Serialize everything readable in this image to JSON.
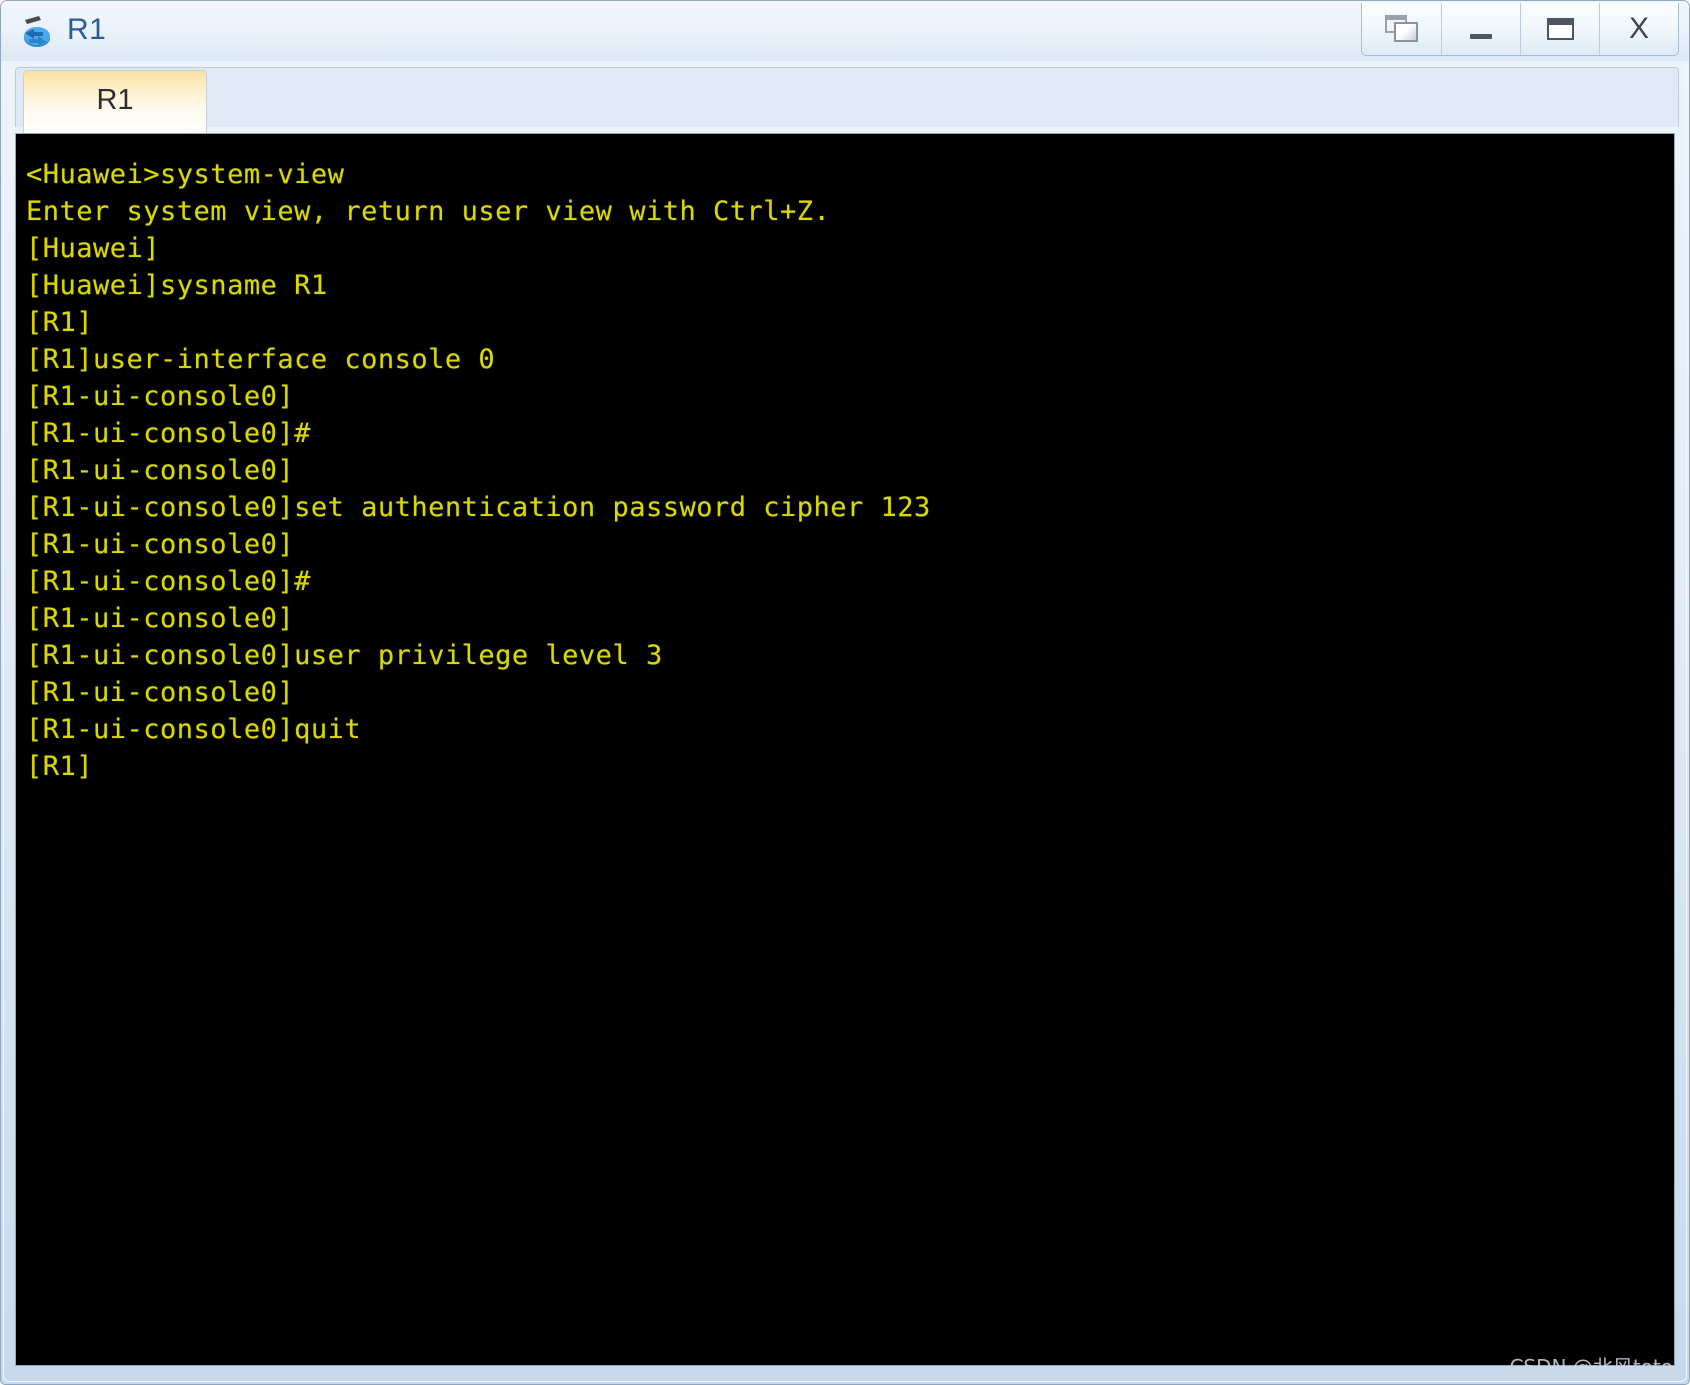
{
  "window": {
    "title": "R1",
    "app_icon": "router-icon",
    "controls": [
      {
        "name": "restore-window-button",
        "icon": "restore-icon",
        "label": ""
      },
      {
        "name": "minimize-window-button",
        "icon": "minimize-icon",
        "label": ""
      },
      {
        "name": "maximize-window-button",
        "icon": "maximize-icon",
        "label": ""
      },
      {
        "name": "close-window-button",
        "icon": "close-icon",
        "label": "X"
      }
    ]
  },
  "tabs": [
    {
      "label": "R1",
      "active": true
    }
  ],
  "terminal": {
    "background_color": "#000000",
    "text_color": "#d9d900",
    "lines": [
      "<Huawei>system-view",
      "Enter system view, return user view with Ctrl+Z.",
      "[Huawei]",
      "[Huawei]sysname R1",
      "[R1]",
      "[R1]user-interface console 0",
      "[R1-ui-console0]",
      "[R1-ui-console0]#",
      "[R1-ui-console0]",
      "[R1-ui-console0]set authentication password cipher 123",
      "[R1-ui-console0]",
      "[R1-ui-console0]#",
      "[R1-ui-console0]",
      "[R1-ui-console0]user privilege level 3",
      "[R1-ui-console0]",
      "[R1-ui-console0]quit",
      "[R1]"
    ]
  },
  "watermark": {
    "text": "CSDN @北风toto"
  }
}
